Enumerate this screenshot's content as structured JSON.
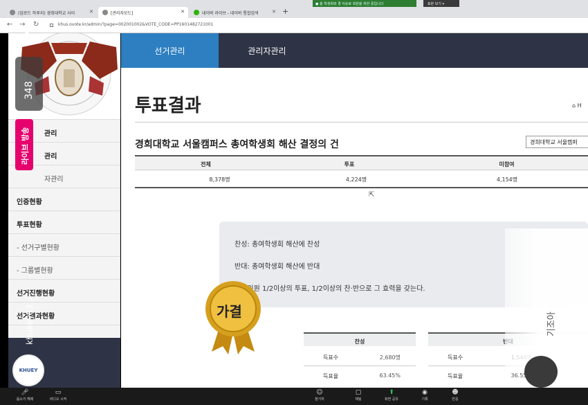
{
  "browser": {
    "tabs": [
      {
        "label": "(업로드 하루지) 경희대학교 사이"
      },
      {
        "label": "[관리자모드]"
      },
      {
        "label": "네이버 라이브 - 네이버 통합검색"
      }
    ],
    "new_tab": "+",
    "notice": "● 총 학생회와 경 이슈로 회원을 위한 중입니다",
    "view_button": "표본 보기 ▾",
    "url": "khus.ovote.kr/admin/?page=002001002&VOTE_CODE=PP1601482721001"
  },
  "sidebar": {
    "logo_text": "KYUNG HEE UNIVERSITY",
    "items": [
      {
        "label": "관리"
      },
      {
        "label": "관리"
      },
      {
        "label": "자관리"
      },
      {
        "label": "인증현황"
      },
      {
        "label": "투표현황"
      },
      {
        "label": "- 선거구별현황"
      },
      {
        "label": "- 그룹별현황"
      },
      {
        "label": "선거진행현황"
      },
      {
        "label": "선거결과현황"
      }
    ]
  },
  "topnav": {
    "election_mgmt": "선거관리",
    "admin_mgmt": "관리자관리"
  },
  "page": {
    "title": "투표결과",
    "breadcrumb": "⌂ H",
    "election_title": "경희대학교 서울캠퍼스 총여학생회 해산 결정의 건",
    "election_select": "경희대학교 서울캠퍼"
  },
  "summary": {
    "headers": [
      "전체",
      "투표",
      "미참여"
    ],
    "values": [
      "8,378명",
      "4,224명",
      "4,154명"
    ]
  },
  "notice": {
    "line1": "찬성: 총여학생회 해산에 찬성",
    "line2": "반대: 총여학생회 해산에 반대",
    "line3": "재적인원 1/2이상의 투표, 1/2이상의 찬·반으로 그 효력을 갖는다."
  },
  "medal": {
    "label": "가결"
  },
  "results": {
    "for_label": "찬성",
    "against_label": "반대",
    "votes_label": "득표수",
    "rate_label": "득표율",
    "for_votes": "2,680명",
    "for_rate": "63.45%",
    "against_votes": "1,544명",
    "against_rate": "36.55%"
  },
  "overlay": {
    "close": "✕",
    "viewers": "348",
    "live_badge": "라이브 방송",
    "streamer": "khukey53",
    "streamer_chevron": ">",
    "badge_text": "KHUEY",
    "side_text": "기조아"
  },
  "bottombar": [
    {
      "label": "음소거 해제",
      "icon": "microphone-icon"
    },
    {
      "label": "비디오 시작",
      "icon": "video-icon"
    },
    {
      "label": "참가자",
      "icon": "participants-icon"
    },
    {
      "label": "채팅",
      "icon": "chat-icon"
    },
    {
      "label": "화면 공유",
      "icon": "share-screen-icon"
    },
    {
      "label": "기록",
      "icon": "record-icon"
    },
    {
      "label": "반응",
      "icon": "reactions-icon"
    }
  ],
  "colors": {
    "nav_active": "#2d7fc1",
    "nav_dark": "#2e3345",
    "live_pink": "#e6006e",
    "medal_gold": "#d6a01e"
  }
}
